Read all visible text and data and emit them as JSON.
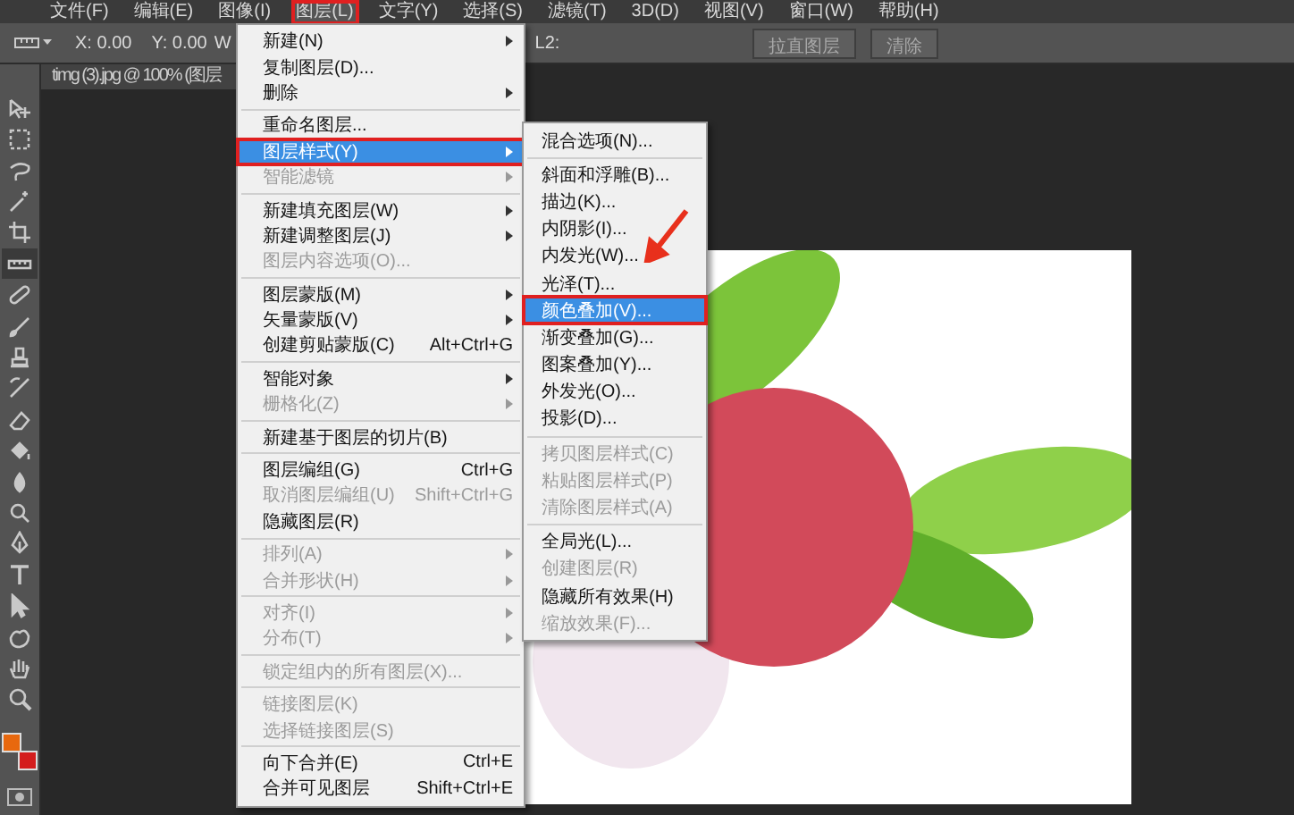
{
  "menubar": [
    {
      "label": "文件(F)",
      "selected": false,
      "marked": false
    },
    {
      "label": "编辑(E)",
      "selected": false,
      "marked": false
    },
    {
      "label": "图像(I)",
      "selected": false,
      "marked": false
    },
    {
      "label": "图层(L)",
      "selected": true,
      "marked": true
    },
    {
      "label": "文字(Y)",
      "selected": false,
      "marked": false
    },
    {
      "label": "选择(S)",
      "selected": false,
      "marked": false
    },
    {
      "label": "滤镜(T)",
      "selected": false,
      "marked": false
    },
    {
      "label": "3D(D)",
      "selected": false,
      "marked": false
    },
    {
      "label": "视图(V)",
      "selected": false,
      "marked": false
    },
    {
      "label": "窗口(W)",
      "selected": false,
      "marked": false
    },
    {
      "label": "帮助(H)",
      "selected": false,
      "marked": false
    }
  ],
  "options_bar": {
    "x": "X: 0.00",
    "y": "Y: 0.00",
    "w": "W",
    "l2": "L2:",
    "buttons": [
      {
        "label": "拉直图层",
        "disabled": true
      },
      {
        "label": "清除",
        "disabled": true
      }
    ]
  },
  "document_tab": {
    "title": "timg (3).jpg @ 100% (图层"
  },
  "tools": [
    {
      "selected": false
    },
    {
      "selected": false
    },
    {
      "selected": false
    },
    {
      "selected": false
    },
    {
      "selected": false
    },
    {
      "selected": true
    },
    {
      "selected": false
    },
    {
      "selected": false
    },
    {
      "selected": false
    },
    {
      "selected": false
    },
    {
      "selected": false
    },
    {
      "selected": false
    },
    {
      "selected": false
    },
    {
      "selected": false
    },
    {
      "selected": false
    },
    {
      "selected": false
    },
    {
      "selected": false
    },
    {
      "selected": false
    },
    {
      "selected": false
    },
    {
      "selected": false
    }
  ],
  "swatches": [
    {
      "kind": "foreground",
      "color": "#e8680e"
    },
    {
      "kind": "background",
      "color": "#d41c1c"
    }
  ],
  "layer_menu": {
    "groups": [
      [
        {
          "label": "新建(N)",
          "submenu": true,
          "disabled": false,
          "selected": false,
          "marked": false
        },
        {
          "label": "复制图层(D)...",
          "submenu": false,
          "disabled": false,
          "selected": false,
          "marked": false
        },
        {
          "label": "删除",
          "submenu": true,
          "disabled": false,
          "selected": false,
          "marked": false
        }
      ],
      [
        {
          "label": "重命名图层...",
          "submenu": false,
          "disabled": false,
          "selected": false,
          "marked": false
        },
        {
          "label": "图层样式(Y)",
          "submenu": true,
          "disabled": false,
          "selected": true,
          "marked": true
        },
        {
          "label": "智能滤镜",
          "submenu": true,
          "disabled": true,
          "selected": false,
          "marked": false
        }
      ],
      [
        {
          "label": "新建填充图层(W)",
          "submenu": true,
          "disabled": false,
          "selected": false,
          "marked": false
        },
        {
          "label": "新建调整图层(J)",
          "submenu": true,
          "disabled": false,
          "selected": false,
          "marked": false
        },
        {
          "label": "图层内容选项(O)...",
          "submenu": false,
          "disabled": true,
          "selected": false,
          "marked": false
        }
      ],
      [
        {
          "label": "图层蒙版(M)",
          "submenu": true,
          "disabled": false,
          "selected": false,
          "marked": false
        },
        {
          "label": "矢量蒙版(V)",
          "submenu": true,
          "disabled": false,
          "selected": false,
          "marked": false
        },
        {
          "label": "创建剪贴蒙版(C)",
          "shortcut": "Alt+Ctrl+G",
          "submenu": false,
          "disabled": false,
          "selected": false,
          "marked": false
        }
      ],
      [
        {
          "label": "智能对象",
          "submenu": true,
          "disabled": false,
          "selected": false,
          "marked": false
        },
        {
          "label": "栅格化(Z)",
          "submenu": true,
          "disabled": true,
          "selected": false,
          "marked": false
        }
      ],
      [
        {
          "label": "新建基于图层的切片(B)",
          "submenu": false,
          "disabled": false,
          "selected": false,
          "marked": false
        }
      ],
      [
        {
          "label": "图层编组(G)",
          "shortcut": "Ctrl+G",
          "submenu": false,
          "disabled": false,
          "selected": false,
          "marked": false
        },
        {
          "label": "取消图层编组(U)",
          "shortcut": "Shift+Ctrl+G",
          "submenu": false,
          "disabled": true,
          "selected": false,
          "marked": false
        },
        {
          "label": "隐藏图层(R)",
          "submenu": false,
          "disabled": false,
          "selected": false,
          "marked": false
        }
      ],
      [
        {
          "label": "排列(A)",
          "submenu": true,
          "disabled": true,
          "selected": false,
          "marked": false
        },
        {
          "label": "合并形状(H)",
          "submenu": true,
          "disabled": true,
          "selected": false,
          "marked": false
        }
      ],
      [
        {
          "label": "对齐(I)",
          "submenu": true,
          "disabled": true,
          "selected": false,
          "marked": false
        },
        {
          "label": "分布(T)",
          "submenu": true,
          "disabled": true,
          "selected": false,
          "marked": false
        }
      ],
      [
        {
          "label": "锁定组内的所有图层(X)...",
          "submenu": false,
          "disabled": true,
          "selected": false,
          "marked": false
        }
      ],
      [
        {
          "label": "链接图层(K)",
          "submenu": false,
          "disabled": true,
          "selected": false,
          "marked": false
        },
        {
          "label": "选择链接图层(S)",
          "submenu": false,
          "disabled": true,
          "selected": false,
          "marked": false
        }
      ],
      [
        {
          "label": "向下合并(E)",
          "shortcut": "Ctrl+E",
          "submenu": false,
          "disabled": false,
          "selected": false,
          "marked": false
        },
        {
          "label": "合并可见图层",
          "shortcut": "Shift+Ctrl+E",
          "submenu": false,
          "disabled": false,
          "selected": false,
          "marked": false
        }
      ]
    ]
  },
  "layer_style_submenu": {
    "groups": [
      [
        {
          "label": "混合选项(N)...",
          "disabled": false,
          "selected": false,
          "marked": false
        }
      ],
      [
        {
          "label": "斜面和浮雕(B)...",
          "disabled": false,
          "selected": false,
          "marked": false
        },
        {
          "label": "描边(K)...",
          "disabled": false,
          "selected": false,
          "marked": false
        },
        {
          "label": "内阴影(I)...",
          "disabled": false,
          "selected": false,
          "marked": false
        },
        {
          "label": "内发光(W)...",
          "disabled": false,
          "selected": false,
          "marked": false
        },
        {
          "label": "光泽(T)...",
          "disabled": false,
          "selected": false,
          "marked": false
        },
        {
          "label": "颜色叠加(V)...",
          "disabled": false,
          "selected": true,
          "marked": true
        },
        {
          "label": "渐变叠加(G)...",
          "disabled": false,
          "selected": false,
          "marked": false
        },
        {
          "label": "图案叠加(Y)...",
          "disabled": false,
          "selected": false,
          "marked": false
        },
        {
          "label": "外发光(O)...",
          "disabled": false,
          "selected": false,
          "marked": false
        },
        {
          "label": "投影(D)...",
          "disabled": false,
          "selected": false,
          "marked": false
        }
      ],
      [
        {
          "label": "拷贝图层样式(C)",
          "disabled": true,
          "selected": false,
          "marked": false
        },
        {
          "label": "粘贴图层样式(P)",
          "disabled": true,
          "selected": false,
          "marked": false
        },
        {
          "label": "清除图层样式(A)",
          "disabled": true,
          "selected": false,
          "marked": false
        }
      ],
      [
        {
          "label": "全局光(L)...",
          "disabled": false,
          "selected": false,
          "marked": false
        },
        {
          "label": "创建图层(R)",
          "disabled": true,
          "selected": false,
          "marked": false
        },
        {
          "label": "隐藏所有效果(H)",
          "disabled": false,
          "selected": false,
          "marked": false
        },
        {
          "label": "缩放效果(F)...",
          "disabled": true,
          "selected": false,
          "marked": false
        }
      ]
    ]
  }
}
